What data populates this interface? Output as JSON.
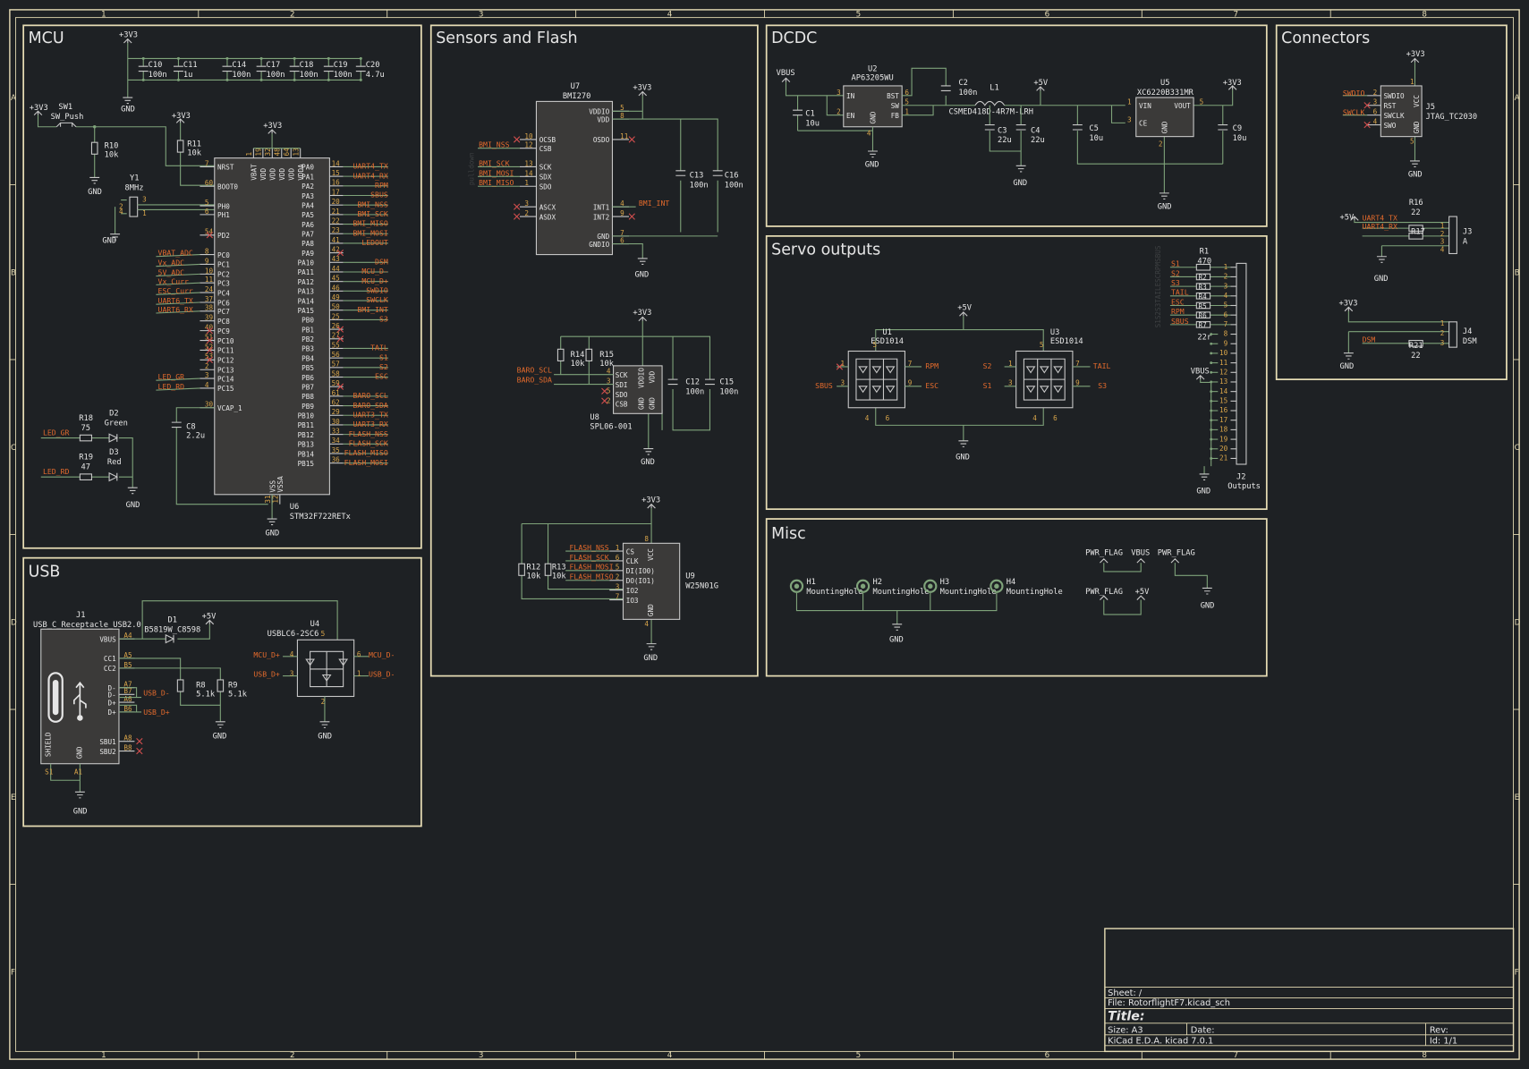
{
  "ruler": {
    "cols": [
      "1",
      "2",
      "3",
      "4",
      "5",
      "6",
      "7",
      "8"
    ],
    "rows": [
      "A",
      "B",
      "C",
      "D",
      "E",
      "F"
    ]
  },
  "panels": {
    "mcu": "MCU",
    "sensors": "Sensors and Flash",
    "dcdc": "DCDC",
    "connectors": "Connectors",
    "usb": "USB",
    "servo": "Servo outputs",
    "misc": "Misc"
  },
  "power": {
    "p3v3": "+3V3",
    "p5v": "+5V",
    "vbus": "VBUS",
    "gnd": "GND",
    "pwr_flag": "PWR_FLAG"
  },
  "mcu": {
    "caps": [
      {
        "ref": "C10",
        "val": "100n"
      },
      {
        "ref": "C11",
        "val": "1u"
      },
      {
        "ref": "C14",
        "val": "100n"
      },
      {
        "ref": "C17",
        "val": "100n"
      },
      {
        "ref": "C18",
        "val": "100n"
      },
      {
        "ref": "C19",
        "val": "100n"
      },
      {
        "ref": "C20",
        "val": "4.7u"
      }
    ],
    "sw1": {
      "ref": "SW1",
      "val": "SW_Push"
    },
    "r10": {
      "ref": "R10",
      "val": "10k"
    },
    "r11": {
      "ref": "R11",
      "val": "10k"
    },
    "y1": {
      "ref": "Y1",
      "val": "8MHz"
    },
    "r18": {
      "ref": "R18",
      "val": "75"
    },
    "r19": {
      "ref": "R19",
      "val": "47"
    },
    "d2": {
      "ref": "D2",
      "val": "Green"
    },
    "d3": {
      "ref": "D3",
      "val": "Red"
    },
    "c8": {
      "ref": "C8",
      "val": "2.2u"
    },
    "u6": {
      "ref": "U6",
      "val": "STM32F722RETx"
    },
    "led_gr": "LED_GR",
    "led_rd": "LED_RD",
    "left_pins": [
      {
        "num": "7",
        "name": "NRST"
      },
      {
        "num": "60",
        "name": "BOOT0"
      },
      {
        "num": "5",
        "name": "PH0"
      },
      {
        "num": "6",
        "name": "PH1"
      },
      {
        "num": "54",
        "name": "PD2"
      },
      {
        "num": "8",
        "name": "PC0"
      },
      {
        "num": "9",
        "name": "PC1"
      },
      {
        "num": "10",
        "name": "PC2"
      },
      {
        "num": "11",
        "name": "PC3"
      },
      {
        "num": "24",
        "name": "PC4"
      },
      {
        "num": "37",
        "name": "PC6"
      },
      {
        "num": "38",
        "name": "PC7"
      },
      {
        "num": "39",
        "name": "PC8"
      },
      {
        "num": "40",
        "name": "PC9"
      },
      {
        "num": "51",
        "name": "PC10"
      },
      {
        "num": "52",
        "name": "PC11"
      },
      {
        "num": "53",
        "name": "PC12"
      },
      {
        "num": "2",
        "name": "PC13"
      },
      {
        "num": "3",
        "name": "PC14"
      },
      {
        "num": "4",
        "name": "PC15"
      },
      {
        "num": "30",
        "name": "VCAP_1"
      }
    ],
    "left_nets": [
      "VBAT_ADC",
      "Vx_ADC",
      "5V_ADC",
      "Vx_Curr",
      "ESC_Curr",
      "UART6_TX",
      "UART6_RX"
    ],
    "left_nets_led": [
      "LED_GR",
      "LED_RD"
    ],
    "right_pins": [
      {
        "num": "14",
        "name": "PA0",
        "net": "UART4_TX"
      },
      {
        "num": "15",
        "name": "PA1",
        "net": "UART4_RX"
      },
      {
        "num": "16",
        "name": "PA2",
        "net": "RPM"
      },
      {
        "num": "17",
        "name": "PA3",
        "net": "SBUS"
      },
      {
        "num": "20",
        "name": "PA4",
        "net": "BMI_NSS"
      },
      {
        "num": "21",
        "name": "PA5",
        "net": "BMI_SCK"
      },
      {
        "num": "22",
        "name": "PA6",
        "net": "BMI_MISO"
      },
      {
        "num": "23",
        "name": "PA7",
        "net": "BMI_MOSI"
      },
      {
        "num": "41",
        "name": "PA8",
        "net": "LEDOUT"
      },
      {
        "num": "42",
        "name": "PA9",
        "net": ""
      },
      {
        "num": "43",
        "name": "PA10",
        "net": "DSM"
      },
      {
        "num": "44",
        "name": "PA11",
        "net": "MCU_D-"
      },
      {
        "num": "45",
        "name": "PA12",
        "net": "MCU_D+"
      },
      {
        "num": "46",
        "name": "PA13",
        "net": "SWDIO"
      },
      {
        "num": "49",
        "name": "PA14",
        "net": "SWCLK"
      },
      {
        "num": "50",
        "name": "PA15",
        "net": "BMI_INT"
      },
      {
        "num": "25",
        "name": "PB0",
        "net": "S3"
      },
      {
        "num": "26",
        "name": "PB1",
        "net": ""
      },
      {
        "num": "27",
        "name": "PB2",
        "net": ""
      },
      {
        "num": "55",
        "name": "PB3",
        "net": "TAIL"
      },
      {
        "num": "56",
        "name": "PB4",
        "net": "S1"
      },
      {
        "num": "57",
        "name": "PB5",
        "net": "S2"
      },
      {
        "num": "58",
        "name": "PB6",
        "net": "ESC"
      },
      {
        "num": "59",
        "name": "PB7",
        "net": ""
      },
      {
        "num": "61",
        "name": "PB8",
        "net": "BARO_SCL"
      },
      {
        "num": "62",
        "name": "PB9",
        "net": "BARO_SDA"
      },
      {
        "num": "29",
        "name": "PB10",
        "net": "UART3_TX"
      },
      {
        "num": "30",
        "name": "PB11",
        "net": "UART3_RX"
      },
      {
        "num": "33",
        "name": "PB12",
        "net": "FLASH_NSS"
      },
      {
        "num": "34",
        "name": "PB13",
        "net": "FLASH_SCK"
      },
      {
        "num": "35",
        "name": "PB14",
        "net": "FLASH_MISO"
      },
      {
        "num": "36",
        "name": "PB15",
        "net": "FLASH_MOSI"
      }
    ],
    "top_pins": [
      "VBAT",
      "VDD",
      "VDD",
      "VDD",
      "VDD",
      "VDDA"
    ],
    "top_nums": [
      "1",
      "19",
      "32",
      "48",
      "64",
      "13"
    ],
    "bot_pins": [
      "VSS",
      "VSSA"
    ],
    "bot_nums": [
      "31",
      "12"
    ]
  },
  "sensors": {
    "u7": {
      "ref": "U7",
      "val": "BMI270"
    },
    "u7_left": [
      {
        "num": "10",
        "name": "OCSB"
      },
      {
        "num": "12",
        "name": "CSB"
      },
      {
        "num": "13",
        "name": "SCK"
      },
      {
        "num": "14",
        "name": "SDX"
      },
      {
        "num": "1",
        "name": "SDO"
      },
      {
        "num": "3",
        "name": "ASCX"
      },
      {
        "num": "2",
        "name": "ASDX"
      }
    ],
    "u7_right": [
      {
        "num": "5",
        "name": "VDDIO"
      },
      {
        "num": "8",
        "name": "VDD"
      },
      {
        "num": "11",
        "name": "OSDO"
      },
      {
        "num": "4",
        "name": "INT1"
      },
      {
        "num": "9",
        "name": "INT2"
      },
      {
        "num": "7",
        "name": "GND"
      },
      {
        "num": "6",
        "name": "GNDIO"
      }
    ],
    "u7_nets": [
      "BMI_NSS",
      "BMI_SCK",
      "BMI_MOSI",
      "BMI_MISO"
    ],
    "bmi_int": "BMI_INT",
    "c13": {
      "ref": "C13",
      "val": "100n"
    },
    "c16": {
      "ref": "C16",
      "val": "100n"
    },
    "u8": {
      "ref": "U8",
      "val": "SPL06-001"
    },
    "r14": {
      "ref": "R14",
      "val": "10k"
    },
    "r15": {
      "ref": "R15",
      "val": "10k"
    },
    "u8_pins": [
      {
        "num": "4",
        "name": "SCK"
      },
      {
        "num": "3",
        "name": "SDI"
      },
      {
        "num": "5",
        "name": "SDO"
      },
      {
        "num": "2",
        "name": "CSB"
      }
    ],
    "u8_nets": [
      "BARO_SCL",
      "BARO_SDA"
    ],
    "c12": {
      "ref": "C12",
      "val": "100n"
    },
    "c15": {
      "ref": "C15",
      "val": "100n"
    },
    "u9": {
      "ref": "U9",
      "val": "W25N01G"
    },
    "r12": {
      "ref": "R12",
      "val": "10k"
    },
    "r13": {
      "ref": "R13",
      "val": "10k"
    },
    "u9_pins": [
      {
        "num": "1",
        "name": "CS"
      },
      {
        "num": "6",
        "name": "CLK"
      },
      {
        "num": "5",
        "name": "DI(IO0)"
      },
      {
        "num": "2",
        "name": "DO(IO1)"
      },
      {
        "num": "3",
        "name": "IO2"
      },
      {
        "num": "7",
        "name": "IO3"
      }
    ],
    "u9_nets": [
      "FLASH_NSS",
      "FLASH_SCK",
      "FLASH_MOSI",
      "FLASH_MISO"
    ]
  },
  "dcdc": {
    "u2": {
      "ref": "U2",
      "val": "AP63205WU"
    },
    "u2_pins": [
      {
        "num": "3",
        "name": "IN"
      },
      {
        "num": "2",
        "name": "EN"
      },
      {
        "num": "6",
        "name": "BST"
      },
      {
        "num": "5",
        "name": "SW"
      },
      {
        "num": "1",
        "name": "FB"
      },
      {
        "num": "4",
        "name": "GND"
      }
    ],
    "c1": {
      "ref": "C1",
      "val": "10u"
    },
    "c2": {
      "ref": "C2",
      "val": "100n"
    },
    "l1": {
      "ref": "L1",
      "val": "CSMED418D-4R7M-LRH"
    },
    "c3": {
      "ref": "C3",
      "val": "22u"
    },
    "c4": {
      "ref": "C4",
      "val": "22u"
    },
    "u5": {
      "ref": "U5",
      "val": "XC6220B331MR"
    },
    "u5_pins": [
      {
        "num": "1",
        "name": "VIN"
      },
      {
        "num": "3",
        "name": "CE"
      },
      {
        "num": "5",
        "name": "VOUT"
      },
      {
        "num": "2",
        "name": "GND"
      }
    ],
    "c5": {
      "ref": "C5",
      "val": "10u"
    },
    "c9": {
      "ref": "C9",
      "val": "10u"
    }
  },
  "connectors": {
    "j5": {
      "ref": "J5",
      "val": "JTAG_TC2030"
    },
    "j5_pins": [
      {
        "num": "2",
        "name": "SWDIO"
      },
      {
        "num": "3",
        "name": "RST"
      },
      {
        "num": "6",
        "name": "SWCLK"
      },
      {
        "num": "4",
        "name": "SWO"
      }
    ],
    "j5_vcc": "VCC",
    "j5_gnd": "GND",
    "j5_nets": [
      "SWDIO",
      "SWCLK"
    ],
    "r16": {
      "ref": "R16",
      "val": "22"
    },
    "r17": {
      "ref": "R17",
      "val": ""
    },
    "j3": {
      "ref": "J3",
      "val": "A"
    },
    "j3_nets": [
      "UART4_TX",
      "UART4_RX"
    ],
    "j4": {
      "ref": "J4",
      "val": "DSM"
    },
    "j4_net": "DSM",
    "r21": {
      "ref": "R21",
      "val": "22"
    }
  },
  "usb": {
    "j1": {
      "ref": "J1",
      "val": "USB_C_Receptacle_USB2.0"
    },
    "d1": {
      "ref": "D1",
      "val": "B5819W_C8598"
    },
    "r8": {
      "ref": "R8",
      "val": "5.1k"
    },
    "r9": {
      "ref": "R9",
      "val": "5.1k"
    },
    "u4": {
      "ref": "U4",
      "val": "USBLC6-2SC6"
    },
    "j1_pins": [
      {
        "num": "A4",
        "name": "VBUS"
      },
      {
        "num": "A5",
        "name": "CC1"
      },
      {
        "num": "B5",
        "name": "CC2"
      },
      {
        "num": "A7",
        "name": "D-"
      },
      {
        "num": "B7",
        "name": "D-"
      },
      {
        "num": "A6",
        "name": "D+"
      },
      {
        "num": "B6",
        "name": "D+"
      },
      {
        "num": "A8",
        "name": "SBU1"
      },
      {
        "num": "B8",
        "name": "SBU2"
      }
    ],
    "j1_shield": "SHIELD",
    "j1_gnd": "GND",
    "j1_s1": "S1",
    "j1_a1": "A1",
    "nets_left": [
      "USB_D-",
      "USB_D+"
    ],
    "u4_left_nets": [
      "MCU_D+",
      "USB_D+"
    ],
    "u4_right_nets": [
      "MCU_D-",
      "USB_D-"
    ]
  },
  "servo": {
    "u1": {
      "ref": "U1",
      "val": "ESD1014"
    },
    "u3": {
      "ref": "U3",
      "val": "ESD1014"
    },
    "u1_left": [
      "SBUS"
    ],
    "u1_right": [
      "RPM",
      "ESC"
    ],
    "u3_left": [
      "S2",
      "S1"
    ],
    "u3_right": [
      "TAIL",
      "S3"
    ],
    "r1": {
      "ref": "R1",
      "val": "470"
    },
    "r7": {
      "ref": "R7",
      "val": "22r"
    },
    "rnet_labels": [
      "S1",
      "S2",
      "S3",
      "TAIL",
      "ESC",
      "RPM",
      "SBUS"
    ],
    "rrefs": [
      "R2",
      "R3",
      "R4",
      "R5",
      "R6",
      "R7"
    ],
    "j2": {
      "ref": "J2",
      "val": "Outputs"
    },
    "j2_pins": [
      "1",
      "2",
      "3",
      "4",
      "5",
      "6",
      "7",
      "8",
      "9",
      "10",
      "11",
      "12",
      "13",
      "14",
      "15",
      "16",
      "17",
      "18",
      "19",
      "20",
      "21"
    ]
  },
  "misc": {
    "holes": [
      {
        "ref": "H1",
        "val": "MountingHole"
      },
      {
        "ref": "H2",
        "val": "MountingHole"
      },
      {
        "ref": "H3",
        "val": "MountingHole"
      },
      {
        "ref": "H4",
        "val": "MountingHole"
      }
    ]
  },
  "titleblock": {
    "sheet": "Sheet: /",
    "file": "File: RotorflightF7.kicad_sch",
    "title": "Title:",
    "size": "Size: A3",
    "date": "Date:",
    "rev": "Rev:",
    "kicad": "KiCad E.D.A.  kicad 7.0.1",
    "id": "Id: 1/1"
  }
}
